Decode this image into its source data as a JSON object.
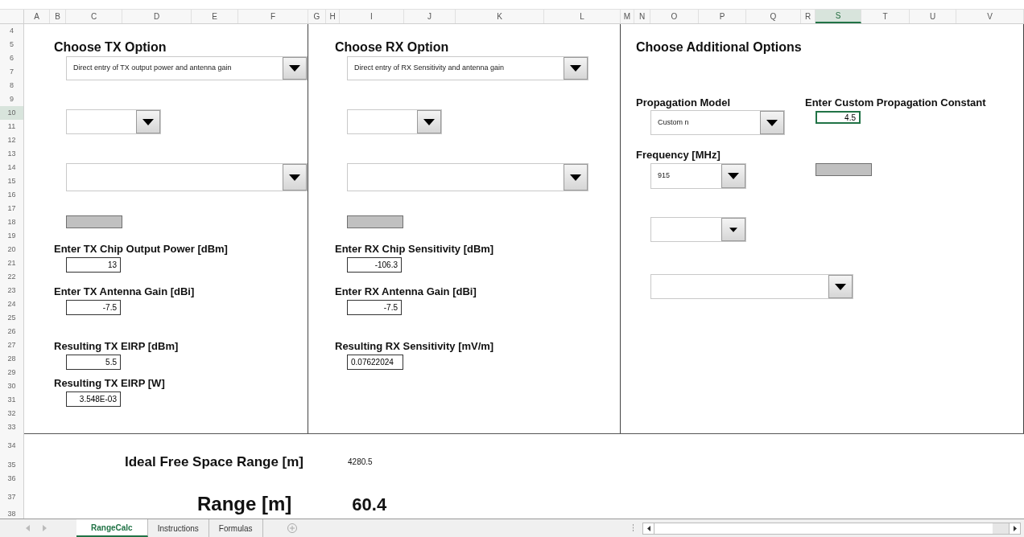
{
  "column_headers": [
    {
      "label": "A",
      "selected": false
    },
    {
      "label": "B",
      "selected": false
    },
    {
      "label": "C",
      "selected": false
    },
    {
      "label": "D",
      "selected": false
    },
    {
      "label": "E",
      "selected": false
    },
    {
      "label": "F",
      "selected": false
    },
    {
      "label": "G",
      "selected": false
    },
    {
      "label": "H",
      "selected": false
    },
    {
      "label": "I",
      "selected": false
    },
    {
      "label": "J",
      "selected": false
    },
    {
      "label": "K",
      "selected": false
    },
    {
      "label": "L",
      "selected": false
    },
    {
      "label": "M",
      "selected": false
    },
    {
      "label": "N",
      "selected": false
    },
    {
      "label": "O",
      "selected": false
    },
    {
      "label": "P",
      "selected": false
    },
    {
      "label": "Q",
      "selected": false
    },
    {
      "label": "R",
      "selected": false
    },
    {
      "label": "S",
      "selected": true
    },
    {
      "label": "T",
      "selected": false
    },
    {
      "label": "U",
      "selected": false
    },
    {
      "label": "V",
      "selected": false
    }
  ],
  "row_headers": [
    "4",
    "5",
    "6",
    "7",
    "8",
    "9",
    "10",
    "11",
    "12",
    "13",
    "14",
    "15",
    "16",
    "17",
    "18",
    "19",
    "20",
    "21",
    "22",
    "23",
    "24",
    "25",
    "26",
    "27",
    "28",
    "29",
    "30",
    "31",
    "32",
    "33",
    "34",
    "35",
    "36",
    "37",
    "38"
  ],
  "tx_panel": {
    "title": "Choose TX Option",
    "option_dropdown": {
      "value": "Direct entry of TX output power and antenna gain"
    },
    "fields": [
      {
        "label": "Enter TX Chip Output Power [dBm]",
        "value": "13"
      },
      {
        "label": "Enter TX Antenna Gain [dBi]",
        "value": "-7.5"
      },
      {
        "label": "Resulting TX EIRP [dBm]",
        "value": "5.5"
      },
      {
        "label": "Resulting TX EIRP [W]",
        "value": "3.548E-03"
      }
    ]
  },
  "rx_panel": {
    "title": "Choose RX Option",
    "option_dropdown": {
      "value": "Direct entry of RX Sensitivity and antenna gain"
    },
    "fields": [
      {
        "label": "Enter RX Chip Sensitivity [dBm]",
        "value": "-106.3"
      },
      {
        "label": "Enter RX Antenna Gain [dBi]",
        "value": "-7.5"
      },
      {
        "label": "Resulting RX Sensitivity [mV/m]",
        "value": "0.07622024"
      }
    ]
  },
  "additional_panel": {
    "title": "Choose Additional Options",
    "propagation_model": {
      "label": "Propagation Model",
      "value": "Custom n"
    },
    "custom_constant": {
      "label": "Enter Custom Propagation Constant",
      "value": "4.5",
      "selected": true
    },
    "frequency": {
      "label": "Frequency [MHz]",
      "value": "915"
    }
  },
  "results": {
    "ideal_range": {
      "label": "Ideal Free Space Range [m]",
      "value": "4280.5"
    },
    "range": {
      "label": "Range [m]",
      "value": "60.4"
    }
  },
  "sheet_tabs": [
    {
      "label": "RangeCalc",
      "selected": true
    },
    {
      "label": "Instructions",
      "selected": false
    },
    {
      "label": "Formulas",
      "selected": false
    }
  ]
}
